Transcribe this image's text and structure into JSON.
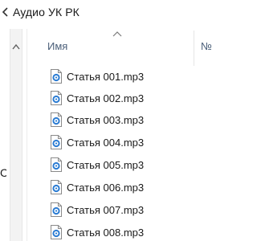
{
  "window": {
    "title": "Аудио УК РК"
  },
  "nav_pane": {
    "clipped_text": "С"
  },
  "columns": {
    "name_label": "Имя",
    "number_label": "№",
    "sort_direction": "ascending"
  },
  "files": [
    {
      "name": "Статья 001.mp3",
      "icon": "audio-file-icon"
    },
    {
      "name": "Статья 002.mp3",
      "icon": "audio-file-icon"
    },
    {
      "name": "Статья 003.mp3",
      "icon": "audio-file-icon"
    },
    {
      "name": "Статья 004.mp3",
      "icon": "audio-file-icon"
    },
    {
      "name": "Статья 005.mp3",
      "icon": "audio-file-icon"
    },
    {
      "name": "Статья 006.mp3",
      "icon": "audio-file-icon"
    },
    {
      "name": "Статья 007.mp3",
      "icon": "audio-file-icon"
    },
    {
      "name": "Статья 008.mp3",
      "icon": "audio-file-icon"
    }
  ],
  "colors": {
    "header_text": "#4c607a",
    "icon_blue": "#2b7cd3",
    "icon_border": "#8a8a8a",
    "hover": "#e5f3ff"
  }
}
